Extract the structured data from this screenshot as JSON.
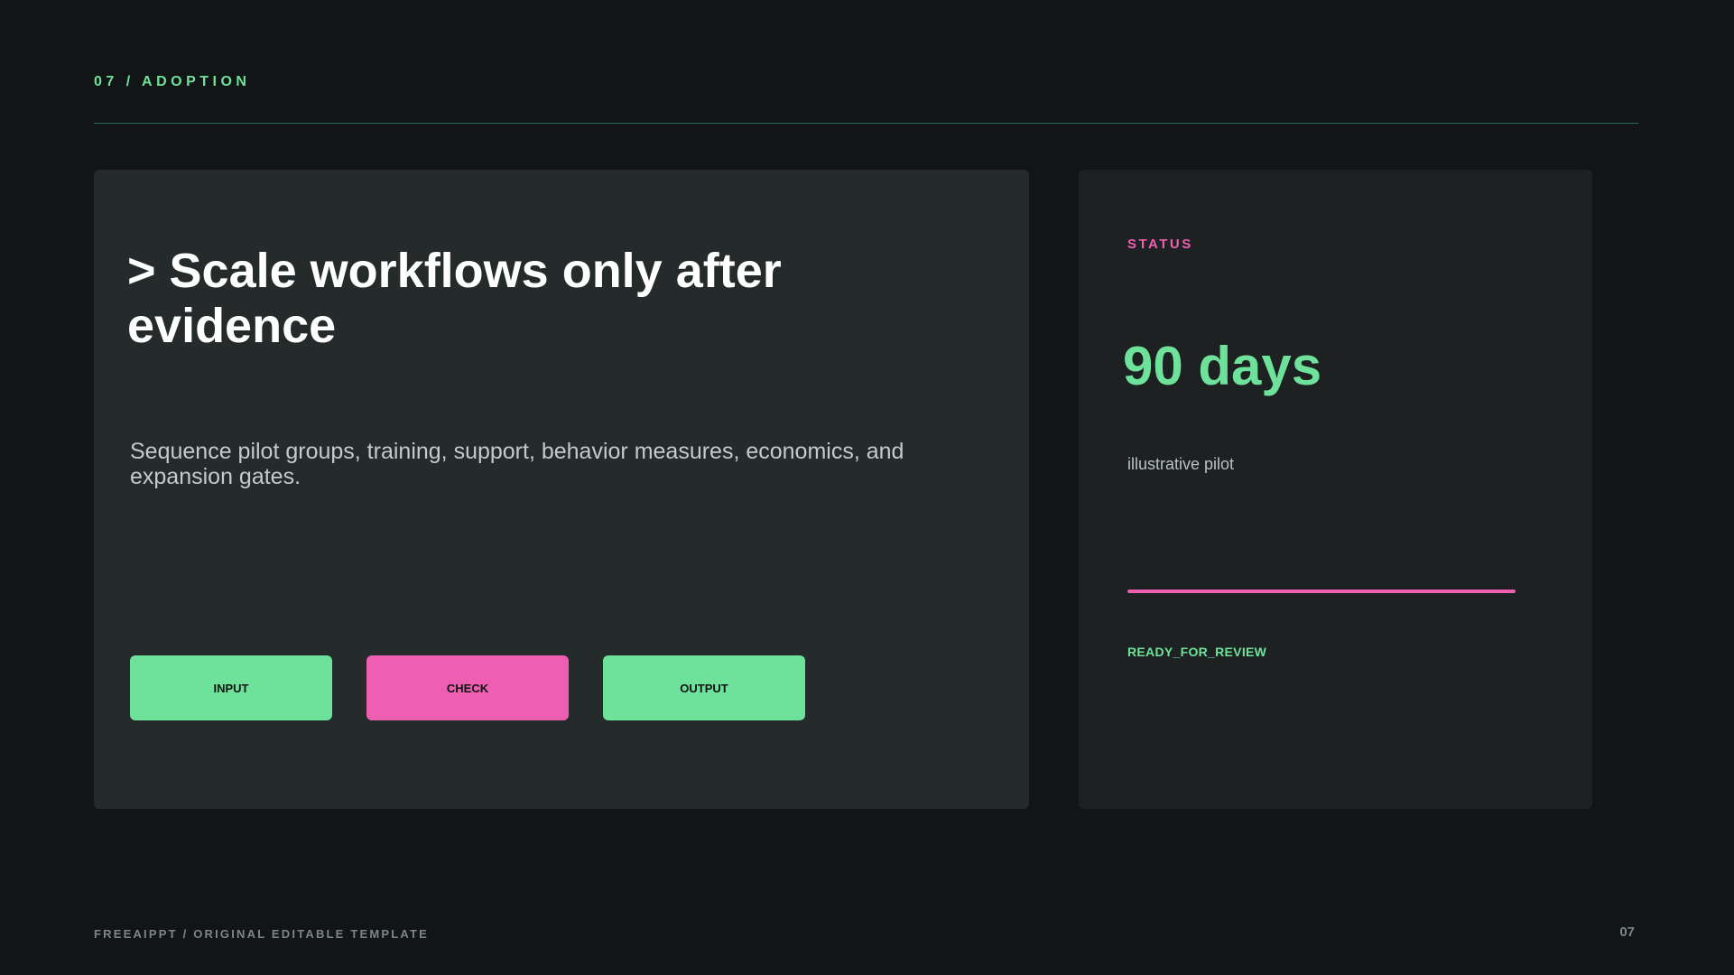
{
  "header": {
    "section_label": "07 / ADOPTION"
  },
  "main_card": {
    "headline": "> Scale workflows only after evidence",
    "subtext": "Sequence pilot groups, training, support, behavior measures, economics, and expansion gates.",
    "flow": [
      {
        "label": "INPUT",
        "color": "#6ee29a"
      },
      {
        "label": "CHECK",
        "color": "#ee5fb2"
      },
      {
        "label": "OUTPUT",
        "color": "#6ee29a"
      }
    ]
  },
  "status_card": {
    "label": "STATUS",
    "value": "90 days",
    "note": "illustrative pilot",
    "progress": 1.0,
    "state": "READY_FOR_REVIEW"
  },
  "footer": {
    "label": "FREEAIPPT / ORIGINAL EDITABLE TEMPLATE",
    "page_number": "07"
  },
  "colors": {
    "background": "#111516",
    "accent_green": "#6ee29a",
    "accent_pink": "#ee5fb2",
    "card": "#252a2b",
    "status_card": "#1d2122"
  }
}
